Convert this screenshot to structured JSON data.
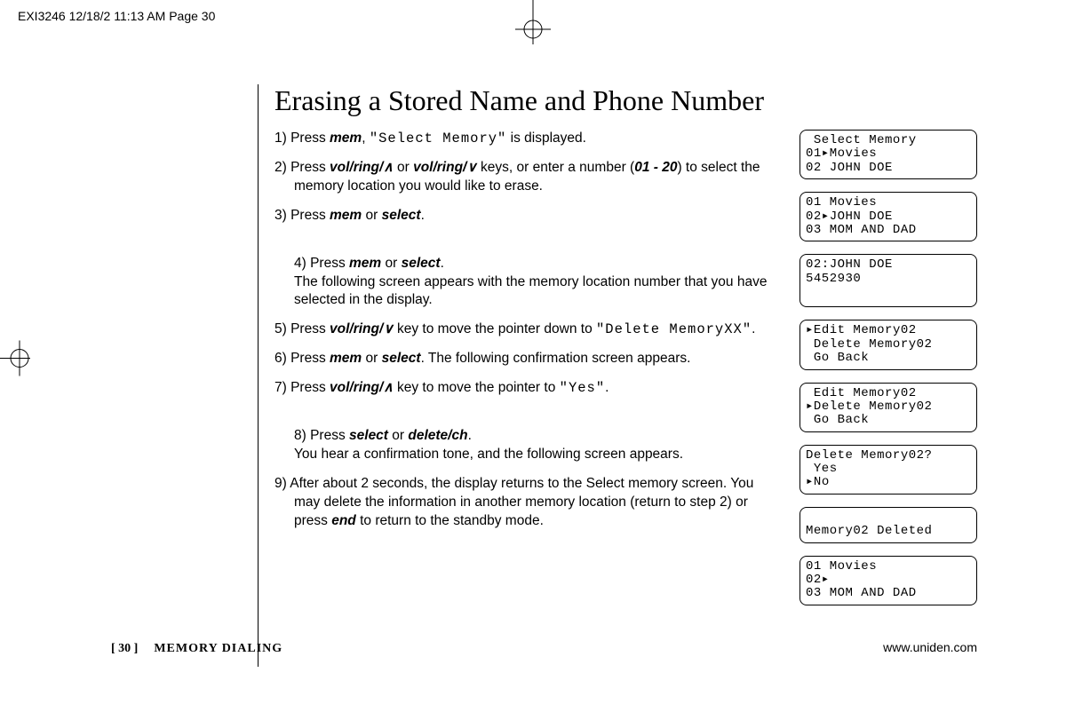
{
  "header": {
    "stamp": "EXI3246  12/18/2 11:13 AM  Page 30"
  },
  "title": "Erasing a Stored Name and Phone Number",
  "steps": {
    "s1a": "1) Press ",
    "s1_mem": "mem",
    "s1b": ", ",
    "s1_lcd": "\"Select Memory\"",
    "s1c": " is displayed.",
    "s2a": "2) Press ",
    "s2_k1": "vol/ring/",
    "s2_up": "∧",
    "s2b": " or ",
    "s2_k2": "vol/ring/",
    "s2_dn": "∨",
    "s2c": " keys, or enter a number (",
    "s2_range": "01 - 20",
    "s2d": ") to select the memory location you would like to erase.",
    "s3a": "3) Press ",
    "s3_mem": "mem",
    "s3b": " or ",
    "s3_sel": "select",
    "s3c": ".",
    "s4a": "4) Press ",
    "s4_mem": "mem",
    "s4b": " or ",
    "s4_sel": "select",
    "s4c": ".\nThe following screen appears with the memory location number that you have selected in the display.",
    "s5a": "5) Press ",
    "s5_k": "vol/ring/",
    "s5_dn": "∨",
    "s5b": " key to move the pointer down to ",
    "s5_lcd": "\"Delete MemoryXX\"",
    "s5c": ".",
    "s6a": "6) Press ",
    "s6_mem": "mem",
    "s6b": " or ",
    "s6_sel": "select",
    "s6c": ". The following confirmation screen appears.",
    "s7a": "7) Press ",
    "s7_k": "vol/ring/",
    "s7_up": "∧",
    "s7b": " key to move the pointer to ",
    "s7_lcd": "\"Yes\"",
    "s7c": ".",
    "s8a": "8) Press ",
    "s8_sel": "select",
    "s8b": " or ",
    "s8_del": "delete/ch",
    "s8c": ".\nYou hear a confirmation tone, and the following screen appears.",
    "s9a": "9) After about 2 seconds, the display returns to the Select memory screen. You may delete the information in another memory location (return to step 2) or press ",
    "s9_end": "end",
    "s9b": " to return to the standby mode."
  },
  "screens": {
    "s1": " Select Memory\n01▸Movies\n02 JOHN DOE",
    "s2": "01 Movies\n02▸JOHN DOE\n03 MOM AND DAD",
    "s3": "02:JOHN DOE\n5452930",
    "s4": "▸Edit Memory02\n Delete Memory02\n Go Back",
    "s5": " Edit Memory02\n▸Delete Memory02\n Go Back",
    "s6": "Delete Memory02?\n Yes\n▸No",
    "s7": "\nMemory02 Deleted\n",
    "s8": "01 Movies\n02▸\n03 MOM AND DAD"
  },
  "footer": {
    "page_num": "[ 30 ]",
    "section": "MEMORY DIALING",
    "url": "www.uniden.com"
  }
}
